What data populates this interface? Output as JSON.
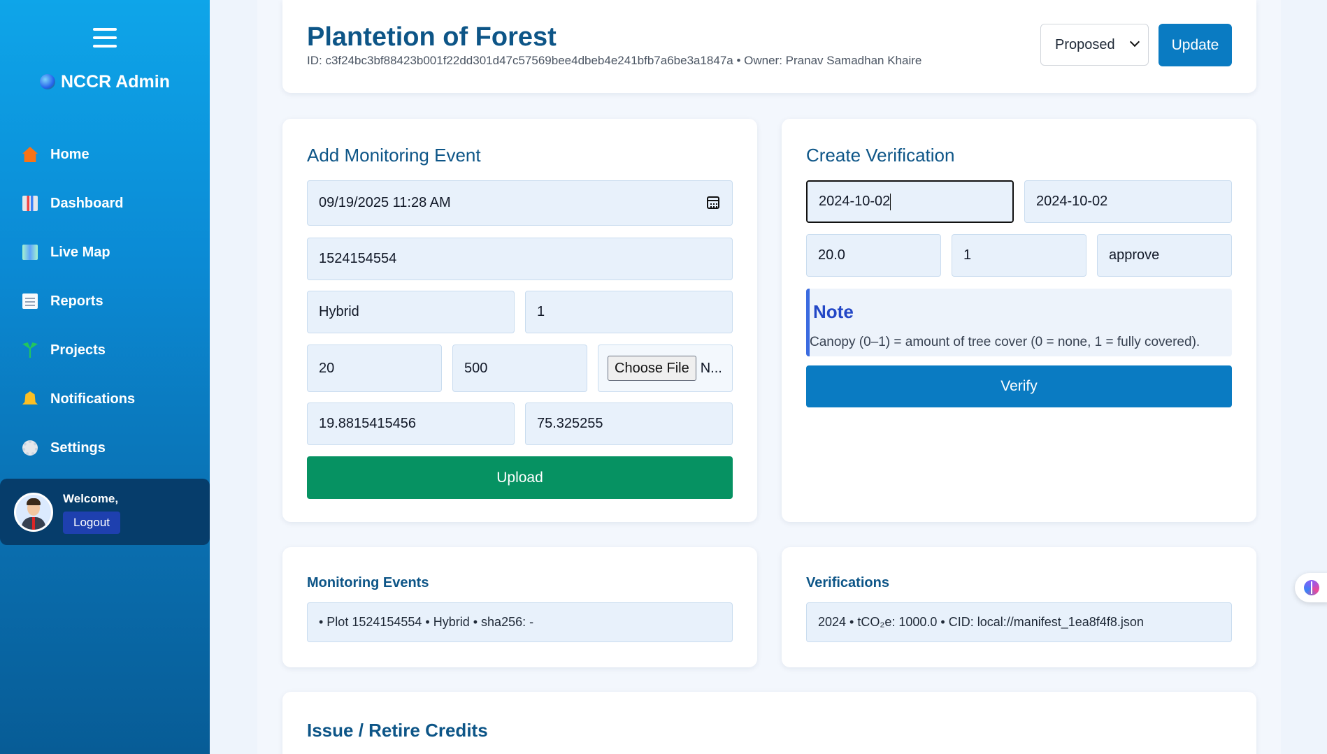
{
  "sidebar": {
    "brand": "NCCR Admin",
    "items": [
      {
        "label": "Home",
        "icon": "home-icon"
      },
      {
        "label": "Dashboard",
        "icon": "bar-chart-icon"
      },
      {
        "label": "Live Map",
        "icon": "map-icon"
      },
      {
        "label": "Reports",
        "icon": "document-icon"
      },
      {
        "label": "Projects",
        "icon": "seedling-icon"
      },
      {
        "label": "Notifications",
        "icon": "bell-icon"
      },
      {
        "label": "Settings",
        "icon": "gear-icon"
      }
    ],
    "welcome": "Welcome,",
    "logout": "Logout"
  },
  "header": {
    "title": "Plantetion of Forest",
    "subtitle": "ID: c3f24bc3bf88423b001f22dd301d47c57569bee4dbeb4e241bfb7a6be3a1847a • Owner: Pranav Samadhan Khaire",
    "status_value": "Proposed",
    "update_label": "Update"
  },
  "monitoring": {
    "title": "Add Monitoring Event",
    "datetime": "09/19/2025 11:28 AM",
    "plot_id": "1524154554",
    "method": "Hybrid",
    "count": "1",
    "value_a": "20",
    "value_b": "500",
    "choose_file": "Choose File",
    "file_status": "N...",
    "latitude": "19.8815415456",
    "longitude": "75.325255",
    "upload_label": "Upload"
  },
  "verification": {
    "title": "Create Verification",
    "date_from": "2024-10-02",
    "date_to": "2024-10-02",
    "value": "20.0",
    "canopy": "1",
    "decision": "approve",
    "note_title": "Note",
    "note_text": "Canopy (0–1) = amount of tree cover (0 = none, 1 = fully covered).",
    "verify_label": "Verify"
  },
  "events_list": {
    "title": "Monitoring Events",
    "items": [
      "• Plot 1524154554 • Hybrid • sha256: -"
    ]
  },
  "verifications_list": {
    "title": "Verifications",
    "items": [
      "2024 • tCO₂e: 1000.0 • CID: local://manifest_1ea8f4f8.json"
    ]
  },
  "issue": {
    "title": "Issue / Retire Credits"
  },
  "colors": {
    "primary": "#0a7bc2",
    "success": "#069262",
    "heading": "#0d5587",
    "sidebar_top": "#0ea5e9",
    "sidebar_bottom": "#075c96"
  }
}
